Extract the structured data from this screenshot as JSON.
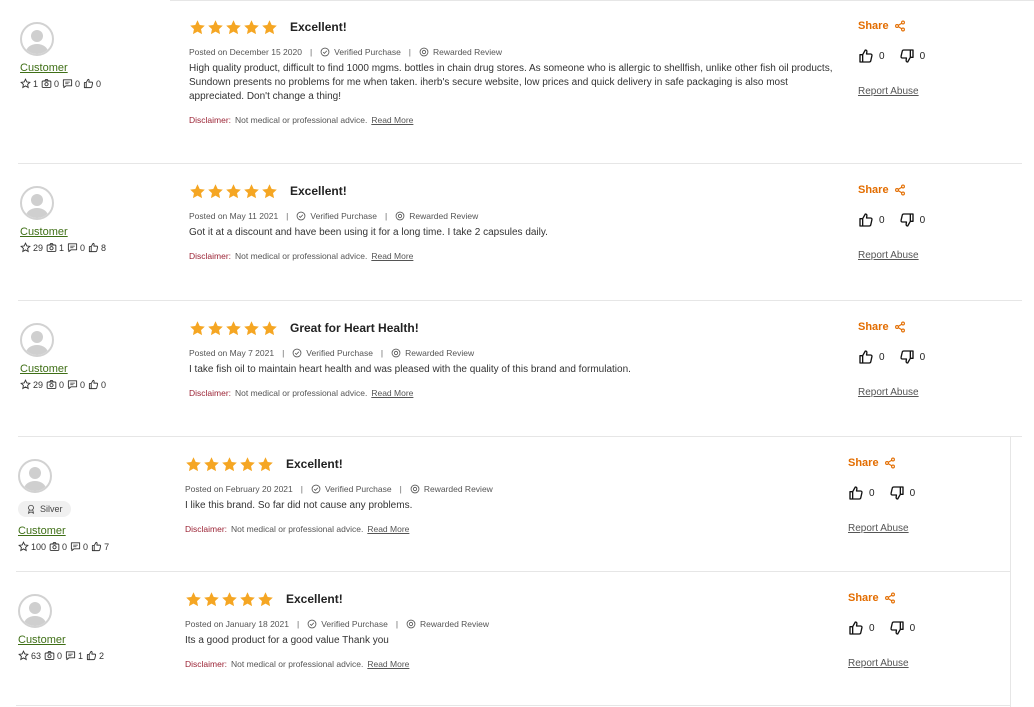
{
  "common": {
    "posted_prefix": "Posted on",
    "verified": "Verified Purchase",
    "rewarded": "Rewarded Review",
    "disclaimer_label": "Disclaimer:",
    "disclaimer_text": "Not medical or professional advice.",
    "read_more": "Read More",
    "share": "Share",
    "report_abuse": "Report Abuse",
    "star_color": "#f5a623",
    "share_color": "#e36d00",
    "username_color": "#3f6f16",
    "disclaimer_color": "#9b2335"
  },
  "reviews": [
    {
      "user": {
        "name": "Customer",
        "badge": "",
        "stars": "1",
        "photos": "0",
        "reviews": "0",
        "likes": "0"
      },
      "rating": 5,
      "title": "Excellent!",
      "date": "December 15 2020",
      "text": "High quality product, difficult to find 1000 mgms. bottles in chain drug stores. As someone who is allergic to shellfish, unlike other fish oil products, Sundown presents no problems for me when taken. iherb's secure website, low prices and quick delivery in safe packaging is also most appreciated. Don't change a thing!",
      "helpful": "0",
      "not_helpful": "0"
    },
    {
      "user": {
        "name": "Customer",
        "badge": "",
        "stars": "29",
        "photos": "1",
        "reviews": "0",
        "likes": "8"
      },
      "rating": 5,
      "title": "Excellent!",
      "date": "May 11 2021",
      "text": "Got it at a discount and have been using it for a long time. I take 2 capsules daily.",
      "helpful": "0",
      "not_helpful": "0"
    },
    {
      "user": {
        "name": "Customer",
        "badge": "",
        "stars": "29",
        "photos": "0",
        "reviews": "0",
        "likes": "0"
      },
      "rating": 5,
      "title": "Great for Heart Health!",
      "date": "May 7 2021",
      "text": "I take fish oil to maintain heart health and was pleased with the quality of this brand and formulation.",
      "helpful": "0",
      "not_helpful": "0"
    },
    {
      "user": {
        "name": "Customer",
        "badge": "Silver",
        "stars": "100",
        "photos": "0",
        "reviews": "0",
        "likes": "7"
      },
      "rating": 5,
      "title": "Excellent!",
      "date": "February 20 2021",
      "text": "I like this brand. So far did not cause any problems.",
      "helpful": "0",
      "not_helpful": "0"
    },
    {
      "user": {
        "name": "Customer",
        "badge": "",
        "stars": "63",
        "photos": "0",
        "reviews": "1",
        "likes": "2"
      },
      "rating": 5,
      "title": "Excellent!",
      "date": "January 18 2021",
      "text": "Its a good product for a good value Thank you",
      "helpful": "0",
      "not_helpful": "0"
    }
  ]
}
